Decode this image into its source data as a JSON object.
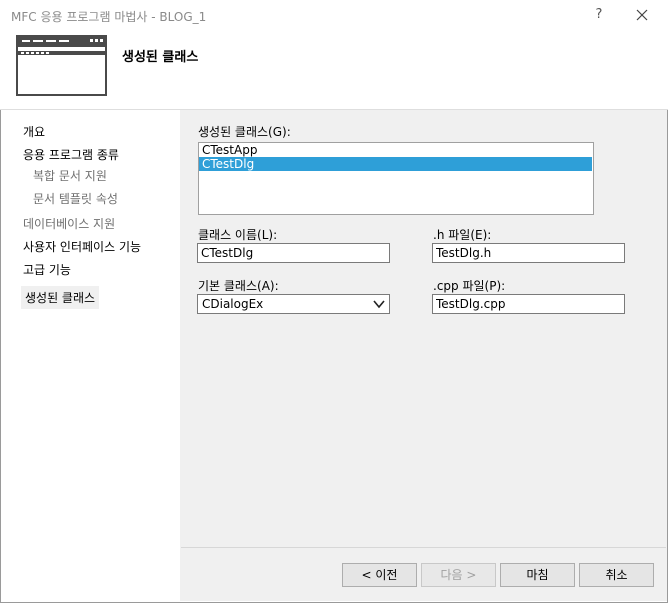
{
  "window": {
    "title": "MFC 응용 프로그램 마법사 - BLOG_1",
    "help_label": "?"
  },
  "header": {
    "title": "생성된 클래스"
  },
  "sidebar": {
    "items": [
      {
        "label": "개요"
      },
      {
        "label": "응용 프로그램 종류"
      },
      {
        "label": "복합 문서 지원"
      },
      {
        "label": "문서 템플릿 속성"
      },
      {
        "label": "데이터베이스 지원"
      },
      {
        "label": "사용자 인터페이스 기능"
      },
      {
        "label": "고급 기능"
      },
      {
        "label": "생성된 클래스"
      }
    ]
  },
  "main": {
    "classes_label": "생성된 클래스(G):",
    "classes": [
      "CTestApp",
      "CTestDlg"
    ],
    "selected_class": "CTestDlg",
    "class_name_label": "클래스 이름(L):",
    "class_name_value": "CTestDlg",
    "h_file_label": ".h 파일(E):",
    "h_file_value": "TestDlg.h",
    "base_class_label": "기본 클래스(A):",
    "base_class_value": "CDialogEx",
    "cpp_file_label": ".cpp 파일(P):",
    "cpp_file_value": "TestDlg.cpp"
  },
  "buttons": {
    "prev": "< 이전",
    "next": "다음 >",
    "finish": "마침",
    "cancel": "취소"
  },
  "colors": {
    "selection": "#2e9fd8",
    "content_bg": "#f0f0f0"
  }
}
